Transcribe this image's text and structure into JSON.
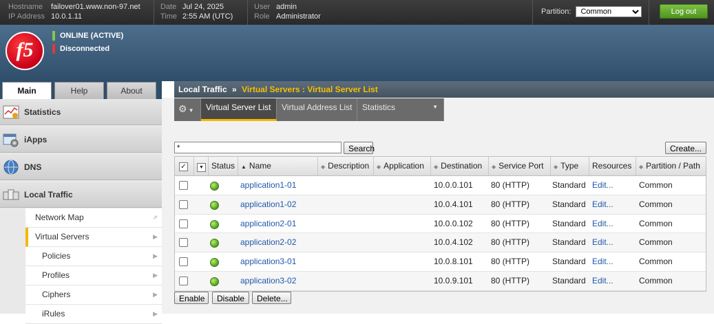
{
  "system": {
    "hostname_label": "Hostname",
    "hostname": "failover01.www.non-97.net",
    "ip_label": "IP Address",
    "ip": "10.0.1.11",
    "date_label": "Date",
    "date": "Jul 24, 2025",
    "time_label": "Time",
    "time": "2:55 AM (UTC)",
    "user_label": "User",
    "user": "admin",
    "role_label": "Role",
    "role": "Administrator",
    "partition_label": "Partition:",
    "partition_value": "Common",
    "logout_label": "Log out"
  },
  "banner": {
    "logo_text": "f5",
    "status_online": "ONLINE (ACTIVE)",
    "status_sync": "Disconnected",
    "online_color": "#8bc34a",
    "sync_color": "#e53935"
  },
  "nav_tabs": [
    "Main",
    "Help",
    "About"
  ],
  "sidebar": {
    "sections": [
      {
        "label": "Statistics",
        "icon": "chart-icon"
      },
      {
        "label": "iApps",
        "icon": "iapps-icon"
      },
      {
        "label": "DNS",
        "icon": "globe-icon"
      },
      {
        "label": "Local Traffic",
        "icon": "local-traffic-icon"
      }
    ],
    "subitems": [
      {
        "label": "Network Map"
      },
      {
        "label": "Virtual Servers"
      },
      {
        "label": "Policies"
      },
      {
        "label": "Profiles"
      },
      {
        "label": "Ciphers"
      },
      {
        "label": "iRules"
      }
    ]
  },
  "breadcrumb": {
    "root": "Local Traffic",
    "sep": "»",
    "current": "Virtual Servers : Virtual Server List"
  },
  "subtabs": [
    "Virtual Server List",
    "Virtual Address List",
    "Statistics"
  ],
  "toolbar": {
    "filter_value": "*",
    "search_label": "Search",
    "create_label": "Create..."
  },
  "table": {
    "columns": [
      "Status",
      "Name",
      "Description",
      "Application",
      "Destination",
      "Service Port",
      "Type",
      "Resources",
      "Partition / Path"
    ],
    "rows": [
      {
        "name": "application1-01",
        "description": "",
        "application": "",
        "destination": "10.0.0.101",
        "port": "80 (HTTP)",
        "type": "Standard",
        "resources": "Edit...",
        "partition": "Common"
      },
      {
        "name": "application1-02",
        "description": "",
        "application": "",
        "destination": "10.0.4.101",
        "port": "80 (HTTP)",
        "type": "Standard",
        "resources": "Edit...",
        "partition": "Common"
      },
      {
        "name": "application2-01",
        "description": "",
        "application": "",
        "destination": "10.0.0.102",
        "port": "80 (HTTP)",
        "type": "Standard",
        "resources": "Edit...",
        "partition": "Common"
      },
      {
        "name": "application2-02",
        "description": "",
        "application": "",
        "destination": "10.0.4.102",
        "port": "80 (HTTP)",
        "type": "Standard",
        "resources": "Edit...",
        "partition": "Common"
      },
      {
        "name": "application3-01",
        "description": "",
        "application": "",
        "destination": "10.0.8.101",
        "port": "80 (HTTP)",
        "type": "Standard",
        "resources": "Edit...",
        "partition": "Common"
      },
      {
        "name": "application3-02",
        "description": "",
        "application": "",
        "destination": "10.0.9.101",
        "port": "80 (HTTP)",
        "type": "Standard",
        "resources": "Edit...",
        "partition": "Common"
      }
    ]
  },
  "actions": [
    "Enable",
    "Disable",
    "Delete..."
  ]
}
